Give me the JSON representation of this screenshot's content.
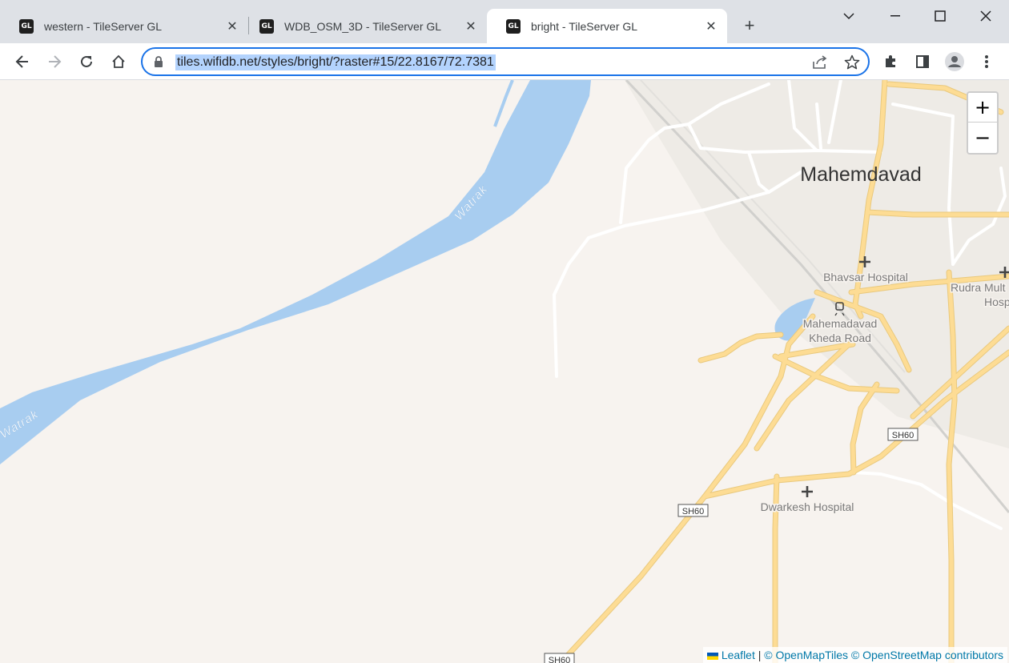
{
  "tabs": [
    {
      "favicon": "GL",
      "title": "western - TileServer GL",
      "close": "✕",
      "active": false
    },
    {
      "favicon": "GL",
      "title": "WDB_OSM_3D - TileServer GL",
      "close": "✕",
      "active": false
    },
    {
      "favicon": "GL",
      "title": "bright - TileServer GL",
      "close": "✕",
      "active": true
    }
  ],
  "new_tab": "+",
  "window_controls": {
    "minimize": "chevron-down-icon",
    "restore": "minimize-icon",
    "maximize": "maximize-icon",
    "close": "close-icon"
  },
  "address_bar": {
    "url": "tiles.wifidb.net/styles/bright/?raster#15/22.8167/72.7381"
  },
  "map": {
    "place_labels": {
      "town": "Mahemdavad"
    },
    "water_labels": [
      "Watrak",
      "Watrak"
    ],
    "poi_labels": {
      "bhavsar": "Bhavsar Hospital",
      "rudra_1": "Rudra Mult",
      "rudra_2": "Hosp",
      "station_1": "Mahemadavad",
      "station_2": "Kheda Road",
      "dwarkesh": "Dwarkesh Hospital"
    },
    "road_shields": [
      "SH60",
      "SH60",
      "SH60"
    ],
    "zoom_in": "+",
    "zoom_out": "−",
    "colors": {
      "land": "#f7f3ef",
      "water": "#a8cdf0",
      "major_road": "#fddc94",
      "minor_road": "#ffffff",
      "railway": "#c8c8c8",
      "urban": "#eeebe6"
    }
  },
  "attribution": {
    "leaflet": "Leaflet",
    "sep": "|",
    "omt": "© OpenMapTiles",
    "osm": "© OpenStreetMap contributors"
  }
}
